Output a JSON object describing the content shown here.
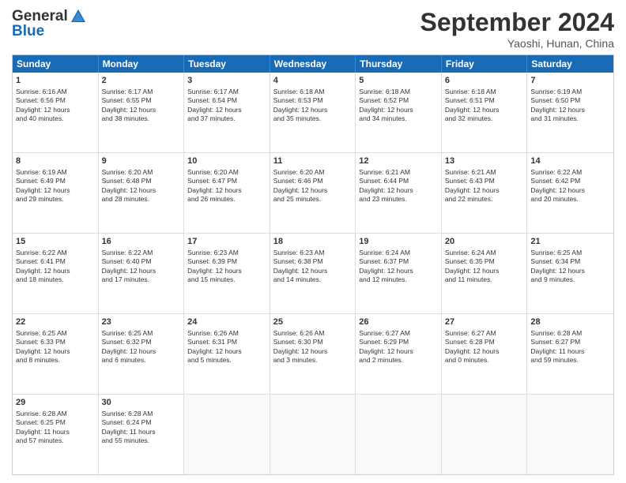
{
  "header": {
    "logo_line1": "General",
    "logo_line2": "Blue",
    "month": "September 2024",
    "location": "Yaoshi, Hunan, China"
  },
  "weekdays": [
    "Sunday",
    "Monday",
    "Tuesday",
    "Wednesday",
    "Thursday",
    "Friday",
    "Saturday"
  ],
  "weeks": [
    [
      {
        "day": "1",
        "lines": [
          "Sunrise: 6:16 AM",
          "Sunset: 6:56 PM",
          "Daylight: 12 hours",
          "and 40 minutes."
        ]
      },
      {
        "day": "2",
        "lines": [
          "Sunrise: 6:17 AM",
          "Sunset: 6:55 PM",
          "Daylight: 12 hours",
          "and 38 minutes."
        ]
      },
      {
        "day": "3",
        "lines": [
          "Sunrise: 6:17 AM",
          "Sunset: 6:54 PM",
          "Daylight: 12 hours",
          "and 37 minutes."
        ]
      },
      {
        "day": "4",
        "lines": [
          "Sunrise: 6:18 AM",
          "Sunset: 6:53 PM",
          "Daylight: 12 hours",
          "and 35 minutes."
        ]
      },
      {
        "day": "5",
        "lines": [
          "Sunrise: 6:18 AM",
          "Sunset: 6:52 PM",
          "Daylight: 12 hours",
          "and 34 minutes."
        ]
      },
      {
        "day": "6",
        "lines": [
          "Sunrise: 6:18 AM",
          "Sunset: 6:51 PM",
          "Daylight: 12 hours",
          "and 32 minutes."
        ]
      },
      {
        "day": "7",
        "lines": [
          "Sunrise: 6:19 AM",
          "Sunset: 6:50 PM",
          "Daylight: 12 hours",
          "and 31 minutes."
        ]
      }
    ],
    [
      {
        "day": "8",
        "lines": [
          "Sunrise: 6:19 AM",
          "Sunset: 6:49 PM",
          "Daylight: 12 hours",
          "and 29 minutes."
        ]
      },
      {
        "day": "9",
        "lines": [
          "Sunrise: 6:20 AM",
          "Sunset: 6:48 PM",
          "Daylight: 12 hours",
          "and 28 minutes."
        ]
      },
      {
        "day": "10",
        "lines": [
          "Sunrise: 6:20 AM",
          "Sunset: 6:47 PM",
          "Daylight: 12 hours",
          "and 26 minutes."
        ]
      },
      {
        "day": "11",
        "lines": [
          "Sunrise: 6:20 AM",
          "Sunset: 6:46 PM",
          "Daylight: 12 hours",
          "and 25 minutes."
        ]
      },
      {
        "day": "12",
        "lines": [
          "Sunrise: 6:21 AM",
          "Sunset: 6:44 PM",
          "Daylight: 12 hours",
          "and 23 minutes."
        ]
      },
      {
        "day": "13",
        "lines": [
          "Sunrise: 6:21 AM",
          "Sunset: 6:43 PM",
          "Daylight: 12 hours",
          "and 22 minutes."
        ]
      },
      {
        "day": "14",
        "lines": [
          "Sunrise: 6:22 AM",
          "Sunset: 6:42 PM",
          "Daylight: 12 hours",
          "and 20 minutes."
        ]
      }
    ],
    [
      {
        "day": "15",
        "lines": [
          "Sunrise: 6:22 AM",
          "Sunset: 6:41 PM",
          "Daylight: 12 hours",
          "and 18 minutes."
        ]
      },
      {
        "day": "16",
        "lines": [
          "Sunrise: 6:22 AM",
          "Sunset: 6:40 PM",
          "Daylight: 12 hours",
          "and 17 minutes."
        ]
      },
      {
        "day": "17",
        "lines": [
          "Sunrise: 6:23 AM",
          "Sunset: 6:39 PM",
          "Daylight: 12 hours",
          "and 15 minutes."
        ]
      },
      {
        "day": "18",
        "lines": [
          "Sunrise: 6:23 AM",
          "Sunset: 6:38 PM",
          "Daylight: 12 hours",
          "and 14 minutes."
        ]
      },
      {
        "day": "19",
        "lines": [
          "Sunrise: 6:24 AM",
          "Sunset: 6:37 PM",
          "Daylight: 12 hours",
          "and 12 minutes."
        ]
      },
      {
        "day": "20",
        "lines": [
          "Sunrise: 6:24 AM",
          "Sunset: 6:35 PM",
          "Daylight: 12 hours",
          "and 11 minutes."
        ]
      },
      {
        "day": "21",
        "lines": [
          "Sunrise: 6:25 AM",
          "Sunset: 6:34 PM",
          "Daylight: 12 hours",
          "and 9 minutes."
        ]
      }
    ],
    [
      {
        "day": "22",
        "lines": [
          "Sunrise: 6:25 AM",
          "Sunset: 6:33 PM",
          "Daylight: 12 hours",
          "and 8 minutes."
        ]
      },
      {
        "day": "23",
        "lines": [
          "Sunrise: 6:25 AM",
          "Sunset: 6:32 PM",
          "Daylight: 12 hours",
          "and 6 minutes."
        ]
      },
      {
        "day": "24",
        "lines": [
          "Sunrise: 6:26 AM",
          "Sunset: 6:31 PM",
          "Daylight: 12 hours",
          "and 5 minutes."
        ]
      },
      {
        "day": "25",
        "lines": [
          "Sunrise: 6:26 AM",
          "Sunset: 6:30 PM",
          "Daylight: 12 hours",
          "and 3 minutes."
        ]
      },
      {
        "day": "26",
        "lines": [
          "Sunrise: 6:27 AM",
          "Sunset: 6:29 PM",
          "Daylight: 12 hours",
          "and 2 minutes."
        ]
      },
      {
        "day": "27",
        "lines": [
          "Sunrise: 6:27 AM",
          "Sunset: 6:28 PM",
          "Daylight: 12 hours",
          "and 0 minutes."
        ]
      },
      {
        "day": "28",
        "lines": [
          "Sunrise: 6:28 AM",
          "Sunset: 6:27 PM",
          "Daylight: 11 hours",
          "and 59 minutes."
        ]
      }
    ],
    [
      {
        "day": "29",
        "lines": [
          "Sunrise: 6:28 AM",
          "Sunset: 6:25 PM",
          "Daylight: 11 hours",
          "and 57 minutes."
        ]
      },
      {
        "day": "30",
        "lines": [
          "Sunrise: 6:28 AM",
          "Sunset: 6:24 PM",
          "Daylight: 11 hours",
          "and 55 minutes."
        ]
      },
      {
        "day": "",
        "lines": []
      },
      {
        "day": "",
        "lines": []
      },
      {
        "day": "",
        "lines": []
      },
      {
        "day": "",
        "lines": []
      },
      {
        "day": "",
        "lines": []
      }
    ]
  ]
}
